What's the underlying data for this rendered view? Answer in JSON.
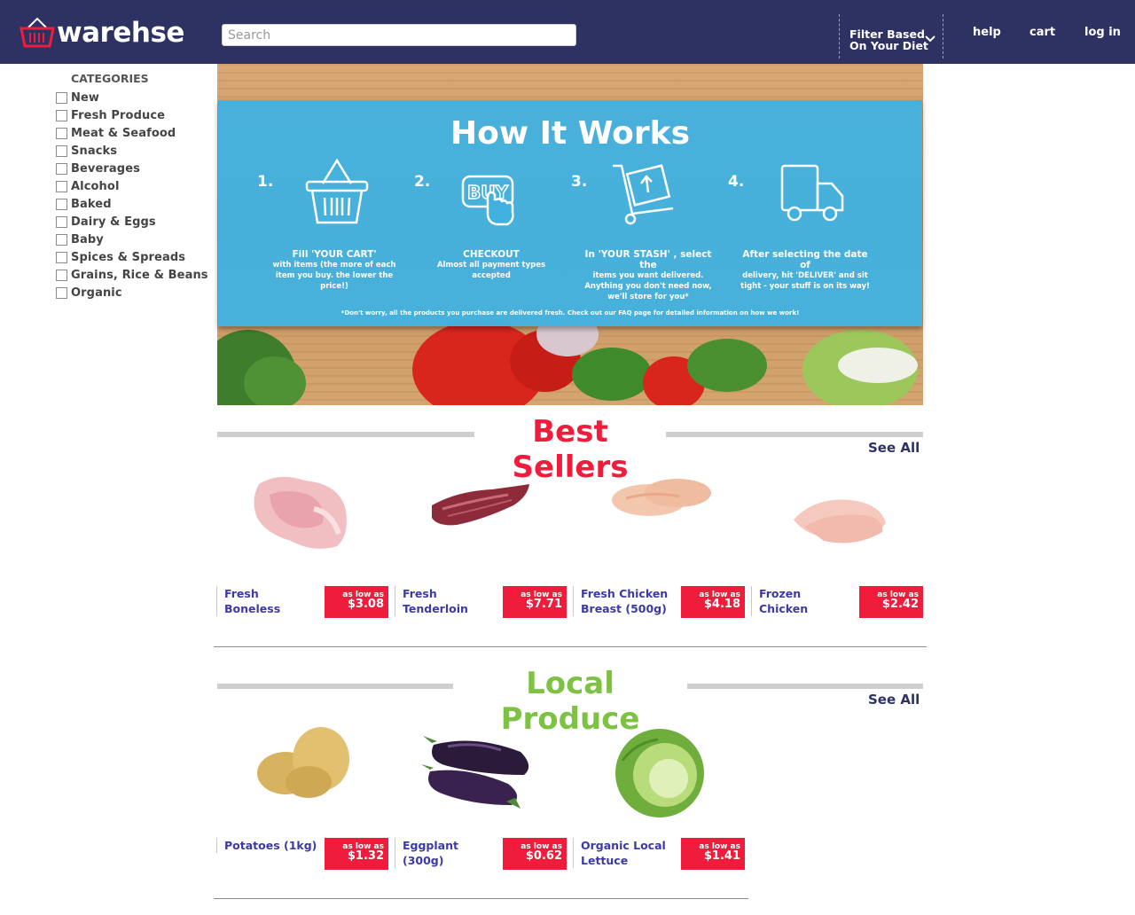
{
  "header": {
    "logo_text": "warehse",
    "search_placeholder": "Search",
    "filter_line1": "Filter Based",
    "filter_line2": "On Your Diet",
    "nav": {
      "help": "help",
      "cart": "cart",
      "login": "log in"
    },
    "bg_color": "#2e3262"
  },
  "sidebar": {
    "title": "CATEGORIES",
    "items": [
      "New",
      "Fresh Produce",
      "Meat & Seafood",
      "Snacks",
      "Beverages",
      "Alcohol",
      "Baked",
      "Dairy & Eggs",
      "Baby",
      "Spices & Spreads",
      "Grains, Rice & Beans",
      "Organic"
    ]
  },
  "how_it_works": {
    "title": "How It Works",
    "steps": [
      {
        "num": "1.",
        "lead": "Fill 'YOUR CART'",
        "text": "with items (the more of each item you buy. the lower the price!)",
        "icon": "basket-icon"
      },
      {
        "num": "2.",
        "lead": "CHECKOUT",
        "text": "Almost all payment types accepted",
        "icon": "buy-button-icon",
        "icon_text": "BUY"
      },
      {
        "num": "3.",
        "lead": "In 'YOUR STASH' , select the",
        "text": "items you want delivered. Anything you don't need now, we'll store for you*",
        "icon": "hand-truck-icon"
      },
      {
        "num": "4.",
        "lead": "After selecting the date of",
        "text": "delivery, hit 'DELIVER' and sit tight - your stuff is on its way!",
        "icon": "delivery-truck-icon"
      }
    ],
    "note": "*Don't worry, all the products you purchase are delivered fresh. Check out our FAQ page for detailed information on how we work!"
  },
  "best_sellers": {
    "title": "Best Sellers",
    "see_all": "See All",
    "color": "#ef1c3b",
    "products": [
      {
        "name_line1": "Fresh",
        "name_line2": "Boneless",
        "price_prefix": "as low as",
        "price": "$3.08",
        "img": "chicken-thigh-image"
      },
      {
        "name_line1": "Fresh",
        "name_line2": "Tenderloin",
        "price_prefix": "as low as",
        "price": "$7.71",
        "img": "beef-tenderloin-image"
      },
      {
        "name_line1": "Fresh Chicken",
        "name_line2": "Breast (500g)",
        "price_prefix": "as low as",
        "price": "$4.18",
        "img": "chicken-breast-image"
      },
      {
        "name_line1": "Frozen",
        "name_line2": "Chicken",
        "price_prefix": "as low as",
        "price": "$2.42",
        "img": "frozen-chicken-image"
      }
    ]
  },
  "local_produce": {
    "title": "Local Produce",
    "see_all": "See All",
    "color": "#7dc242",
    "products": [
      {
        "name_line1": "Potatoes (1kg)",
        "name_line2": "",
        "price_prefix": "as low as",
        "price": "$1.32",
        "img": "potatoes-image"
      },
      {
        "name_line1": "Eggplant",
        "name_line2": "(300g)",
        "price_prefix": "as low as",
        "price": "$0.62",
        "img": "eggplant-image"
      },
      {
        "name_line1": "Organic Local",
        "name_line2": "Lettuce",
        "price_prefix": "as low as",
        "price": "$1.41",
        "img": "lettuce-image"
      }
    ]
  }
}
